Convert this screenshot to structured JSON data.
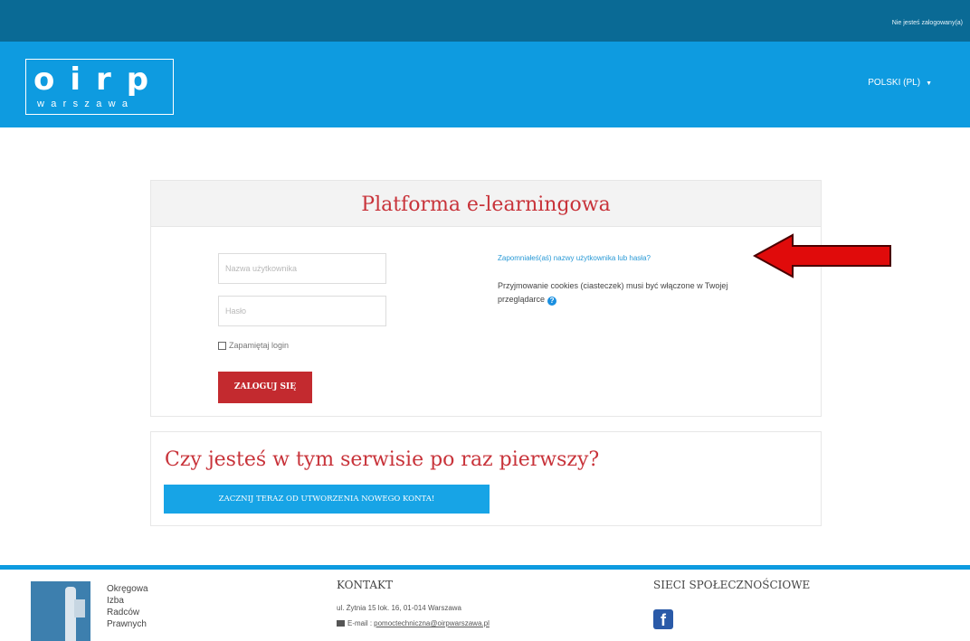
{
  "topbar": {
    "login_status": "Nie jesteś zalogowany(a)"
  },
  "header": {
    "logo_letters": "oirp",
    "logo_sub": "warszawa",
    "language": "POLSKI (PL)"
  },
  "login": {
    "title": "Platforma e-learningowa",
    "username_placeholder": "Nazwa użytkownika",
    "password_placeholder": "Hasło",
    "remember_label": "Zapamiętaj login",
    "submit_label": "ZALOGUJ SIĘ",
    "forgot_link": "Zapomniałeś(aś) nazwy użytkownika lub hasła?",
    "cookies_note": "Przyjmowanie cookies (ciasteczek) musi być włączone w Twojej przeglądarce"
  },
  "signup": {
    "title": "Czy jesteś w tym serwisie po raz pierwszy?",
    "button_label": "ZACZNIJ TERAZ OD UTWORZENIA NOWEGO KONTA!"
  },
  "footer": {
    "org_lines": [
      "Okręgowa",
      "Izba",
      "Radców",
      "Prawnych"
    ],
    "contact_heading": "KONTAKT",
    "address": "ul. Żytnia 15 lok. 16, 01-014 Warszawa",
    "email_label": "E-mail :",
    "email": "pomoctechniczna@oirpwarszawa.pl",
    "social_heading": "SIECI SPOŁECZNOŚCIOWE"
  },
  "icons": {
    "arrow": "red-arrow-icon",
    "help": "help-icon",
    "envelope": "envelope-icon",
    "facebook": "facebook-icon"
  },
  "colors": {
    "topbar": "#0a6a95",
    "header": "#0e9be0",
    "brand_red": "#c32a2f",
    "signup_blue": "#17a4e6"
  }
}
